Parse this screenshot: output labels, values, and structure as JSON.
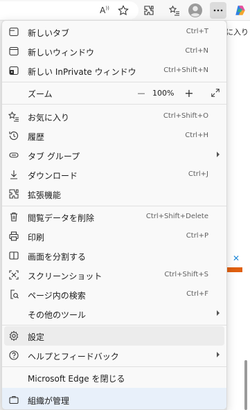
{
  "toolbar": {
    "buttons": [
      {
        "name": "read-aloud-icon"
      },
      {
        "name": "favorite-star-icon"
      },
      {
        "name": "extensions-icon"
      },
      {
        "name": "favorites-list-icon"
      },
      {
        "name": "profile-icon"
      },
      {
        "name": "more-menu-icon"
      },
      {
        "name": "copilot-icon"
      }
    ]
  },
  "background": {
    "text": "に入り"
  },
  "menu": {
    "new_tab": {
      "label": "新しいタブ",
      "shortcut": "Ctrl+T"
    },
    "new_window": {
      "label": "新しいウィンドウ",
      "shortcut": "Ctrl+N"
    },
    "new_inprivate": {
      "label": "新しい InPrivate ウィンドウ",
      "shortcut": "Ctrl+Shift+N"
    },
    "zoom": {
      "label": "ズーム",
      "minus": "—",
      "value": "100%",
      "plus": "+"
    },
    "favorites": {
      "label": "お気に入り",
      "shortcut": "Ctrl+Shift+O"
    },
    "history": {
      "label": "履歴",
      "shortcut": "Ctrl+H"
    },
    "tab_groups": {
      "label": "タブ グループ"
    },
    "downloads": {
      "label": "ダウンロード",
      "shortcut": "Ctrl+J"
    },
    "extensions": {
      "label": "拡張機能"
    },
    "clear_data": {
      "label": "閲覧データを削除",
      "shortcut": "Ctrl+Shift+Delete"
    },
    "print": {
      "label": "印刷",
      "shortcut": "Ctrl+P"
    },
    "split_screen": {
      "label": "画面を分割する"
    },
    "screenshot": {
      "label": "スクリーンショット",
      "shortcut": "Ctrl+Shift+S"
    },
    "find": {
      "label": "ページ内の検索",
      "shortcut": "Ctrl+F"
    },
    "more_tools": {
      "label": "その他のツール"
    },
    "settings": {
      "label": "設定"
    },
    "help": {
      "label": "ヘルプとフィードバック"
    },
    "close_edge": {
      "label": "Microsoft Edge を閉じる"
    },
    "managed": {
      "label": "組織が管理"
    }
  }
}
